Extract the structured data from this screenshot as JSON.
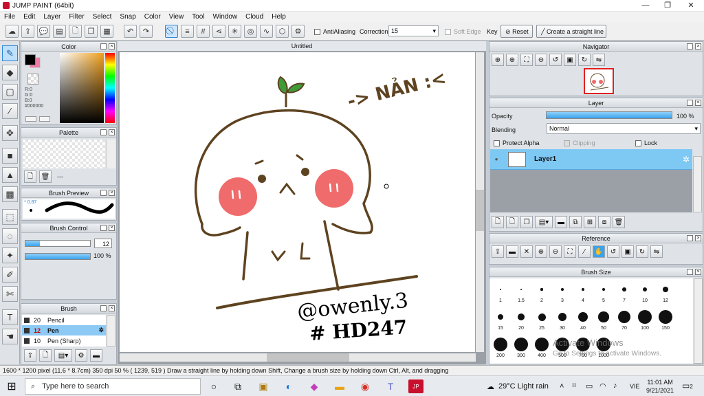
{
  "app": {
    "title": "JUMP PAINT (64bit)"
  },
  "menu": [
    "File",
    "Edit",
    "Layer",
    "Filter",
    "Select",
    "Snap",
    "Color",
    "View",
    "Tool",
    "Window",
    "Cloud",
    "Help"
  ],
  "toolbar": {
    "antialiasing": "AntiAliasing",
    "correction_label": "Correction",
    "correction_value": "15",
    "soft_edge": "Soft Edge",
    "key": "Key",
    "reset": "Reset",
    "straight_line": "Create a straight line"
  },
  "color_panel": {
    "title": "Color",
    "r": "R:0",
    "g": "G:0",
    "b": "B:0",
    "hex": "#000000",
    "main_color": "#000000",
    "sub_color": "#f07aa5"
  },
  "palette_panel": {
    "title": "Palette",
    "dash": "---"
  },
  "brush_preview": {
    "title": "Brush Preview",
    "size": "0.87"
  },
  "brush_control": {
    "title": "Brush Control",
    "size_value": "12",
    "opacity_value": "100 %",
    "size_fraction": 0.22,
    "opacity_fraction": 1.0
  },
  "brush_panel": {
    "title": "Brush",
    "items": [
      {
        "size": "20",
        "name": "Pencil"
      },
      {
        "size": "12",
        "name": "Pen"
      },
      {
        "size": "10",
        "name": "Pen (Sharp)"
      }
    ]
  },
  "document": {
    "title": "Untitled"
  },
  "artwork": {
    "handle": "@owenly.3",
    "tag": "# HD247",
    "note": "-> NẢN :<"
  },
  "navigator": {
    "title": "Navigator"
  },
  "layer_panel": {
    "title": "Layer",
    "opacity_label": "Opacity",
    "opacity_value": "100 %",
    "opacity_fraction": 1.0,
    "blending_label": "Blending",
    "blending_value": "Normal",
    "protect_alpha": "Protect Alpha",
    "clipping": "Clipping",
    "lock": "Lock",
    "layer_name": "Layer1"
  },
  "reference_panel": {
    "title": "Reference"
  },
  "brush_size_panel": {
    "title": "Brush Size",
    "sizes": [
      "1",
      "1.5",
      "2",
      "3",
      "4",
      "5",
      "7",
      "10",
      "12",
      "15",
      "20",
      "25",
      "30",
      "40",
      "50",
      "70",
      "100",
      "150",
      "200",
      "300",
      "400",
      "500",
      "700",
      "1000"
    ]
  },
  "watermark": {
    "line1": "Activate Windows",
    "line2": "Go to Settings to activate Windows."
  },
  "status": {
    "text": "1600 * 1200 pixel   (11.6 * 8.7cm)   350 dpi   50 %   ( 1239, 519 )   Draw a straight line by holding down Shift, Change a brush size by holding down Ctrl, Alt, and dragging"
  },
  "taskbar": {
    "search_placeholder": "Type here to search",
    "weather": "29°C  Light rain",
    "lang": "VIE",
    "time": "11:01 AM",
    "date": "9/21/2021",
    "notif": "2"
  }
}
